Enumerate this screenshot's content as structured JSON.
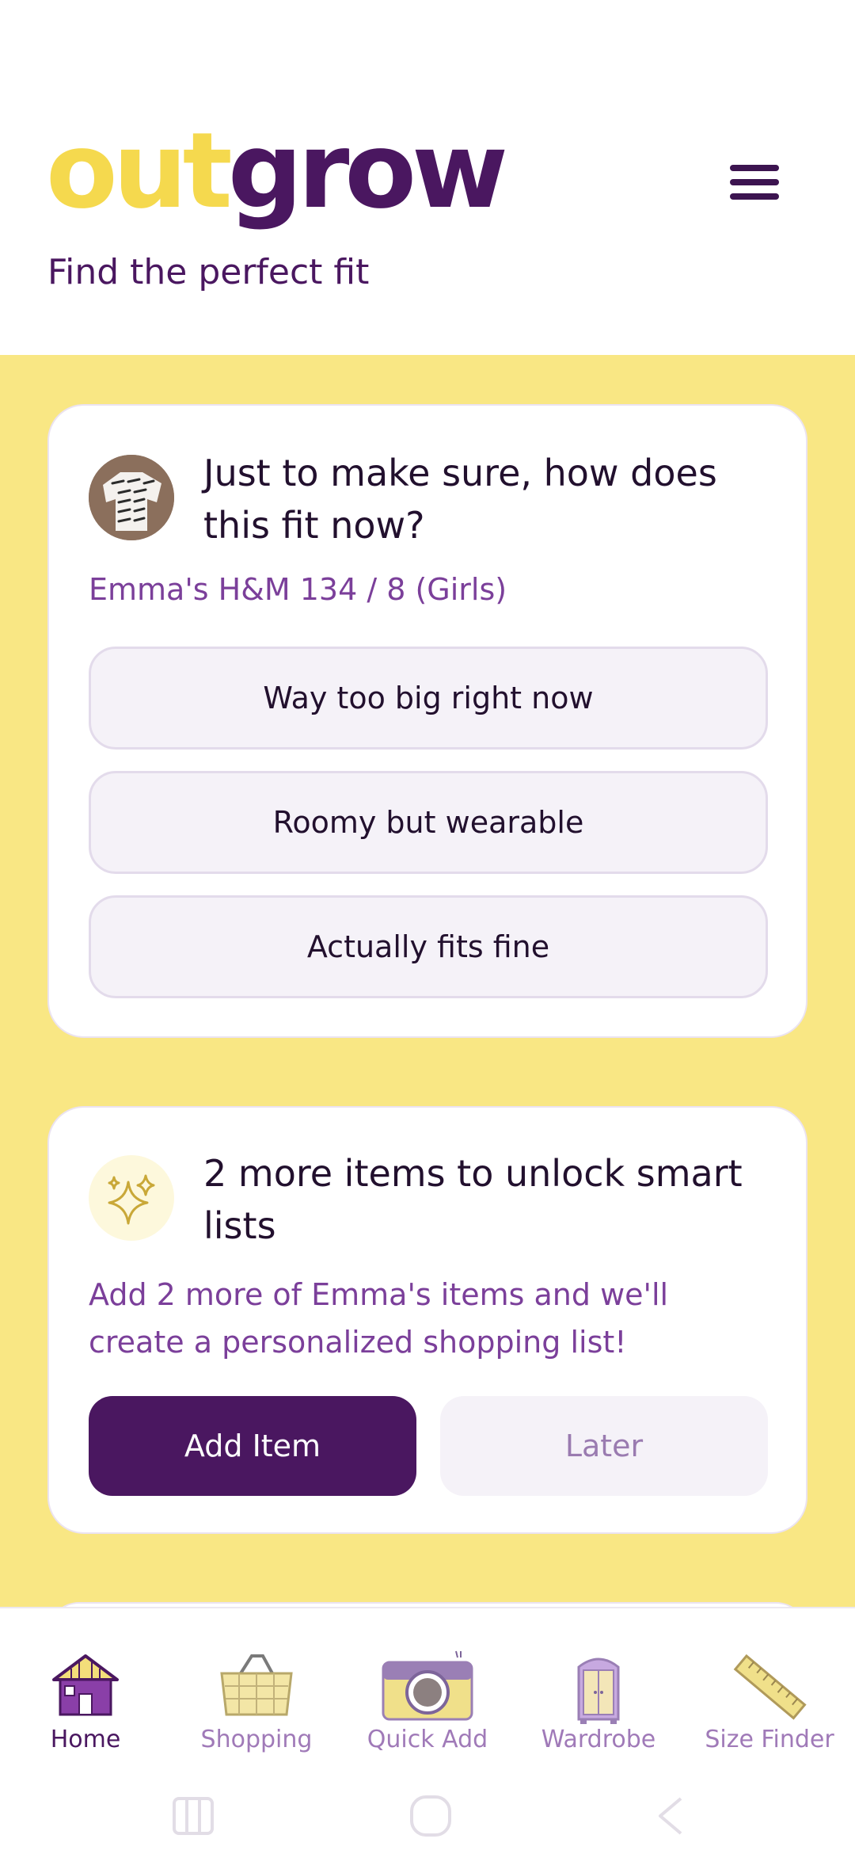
{
  "header": {
    "logo_part1": "out",
    "logo_part2": "grow",
    "tagline": "Find the perfect fit",
    "menu_icon": "hamburger-menu-icon"
  },
  "fit_check": {
    "title": "Just to make sure, how does this fit now?",
    "item": "Emma's H&M 134 / 8 (Girls)",
    "options": [
      "Way too big right now",
      "Roomy but wearable",
      "Actually fits fine"
    ]
  },
  "promo": {
    "icon": "sparkles-icon",
    "title": "2 more items to unlock smart lists",
    "body": "Add 2 more of Emma's items and we'll create a personalized shopping list!",
    "primary_label": "Add Item",
    "secondary_label": "Later"
  },
  "nav": {
    "items": [
      {
        "label": "Home",
        "icon": "house-icon",
        "active": true
      },
      {
        "label": "Shopping",
        "icon": "basket-icon",
        "active": false
      },
      {
        "label": "Quick Add",
        "icon": "camera-icon",
        "active": false
      },
      {
        "label": "Wardrobe",
        "icon": "wardrobe-icon",
        "active": false
      },
      {
        "label": "Size Finder",
        "icon": "ruler-icon",
        "active": false
      }
    ]
  },
  "colors": {
    "brand_purple": "#4a1760",
    "brand_yellow": "#f5d94e",
    "feed_background": "#f9e784",
    "accent_text": "#7b3f9a"
  }
}
